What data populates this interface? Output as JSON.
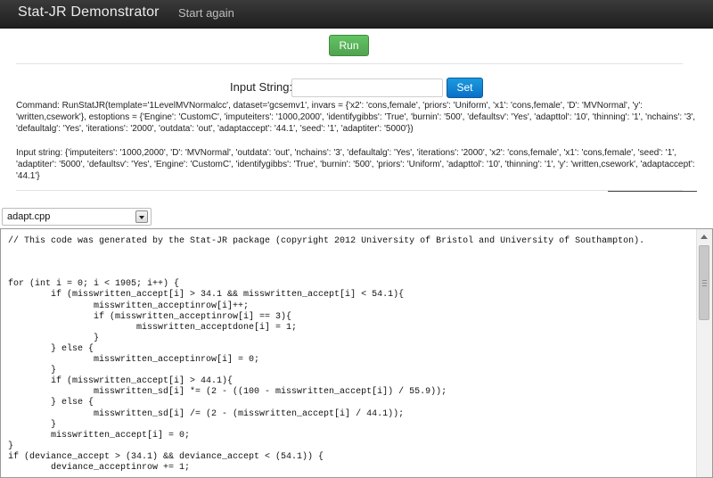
{
  "navbar": {
    "brand": "Stat-JR Demonstrator",
    "start_again": "Start again"
  },
  "run_button": "Run",
  "input_form": {
    "label": "Input String:",
    "value": "",
    "placeholder": "",
    "set_button": "Set"
  },
  "command_text": "Command: RunStatJR(template='1LevelMVNormalcc', dataset='gcsemv1', invars = {'x2': 'cons,female', 'priors': 'Uniform', 'x1': 'cons,female', 'D': 'MVNormal', 'y': 'written,csework'}, estoptions = {'Engine': 'CustomC', 'imputeiters': '1000,2000', 'identifygibbs': 'True', 'burnin': '500', 'defaultsv': 'Yes', 'adapttol': '10', 'thinning': '1', 'nchains': '3', 'defaultalg': 'Yes', 'iterations': '2000', 'outdata': 'out', 'adaptaccept': '44.1', 'seed': '1', 'adaptiter': '5000'})",
  "input_string_text": "Input string: {'imputeiters': '1000,2000', 'D': 'MVNormal', 'outdata': 'out', 'nchains': '3', 'defaultalg': 'Yes', 'iterations': '2000', 'x2': 'cons,female', 'x1': 'cons,female', 'seed': '1', 'adaptiter': '5000', 'defaultsv': 'Yes', 'Engine': 'CustomC', 'identifygibbs': 'True', 'burnin': '500', 'priors': 'Uniform', 'adapttol': '10', 'thinning': '1', 'y': 'written,csework', 'adaptaccept': '44.1'}",
  "file_select": {
    "selected": "adapt.cpp"
  },
  "code_lines": [
    "// This code was generated by the Stat-JR package (copyright 2012 University of Bristol and University of Southampton).",
    "",
    "",
    "",
    "for (int i = 0; i < 1905; i++) {",
    "        if (misswritten_accept[i] > 34.1 && misswritten_accept[i] < 54.1){",
    "                misswritten_acceptinrow[i]++;",
    "                if (misswritten_acceptinrow[i] == 3){",
    "                        misswritten_acceptdone[i] = 1;",
    "                }",
    "        } else {",
    "                misswritten_acceptinrow[i] = 0;",
    "        }",
    "        if (misswritten_accept[i] > 44.1){",
    "                misswritten_sd[i] *= (2 - ((100 - misswritten_accept[i]) / 55.9));",
    "        } else {",
    "                misswritten_sd[i] /= (2 - (misswritten_accept[i] / 44.1));",
    "        }",
    "        misswritten_accept[i] = 0;",
    "}",
    "if (deviance_accept > (34.1) && deviance_accept < (54.1)) {",
    "        deviance_acceptinrow += 1;"
  ]
}
